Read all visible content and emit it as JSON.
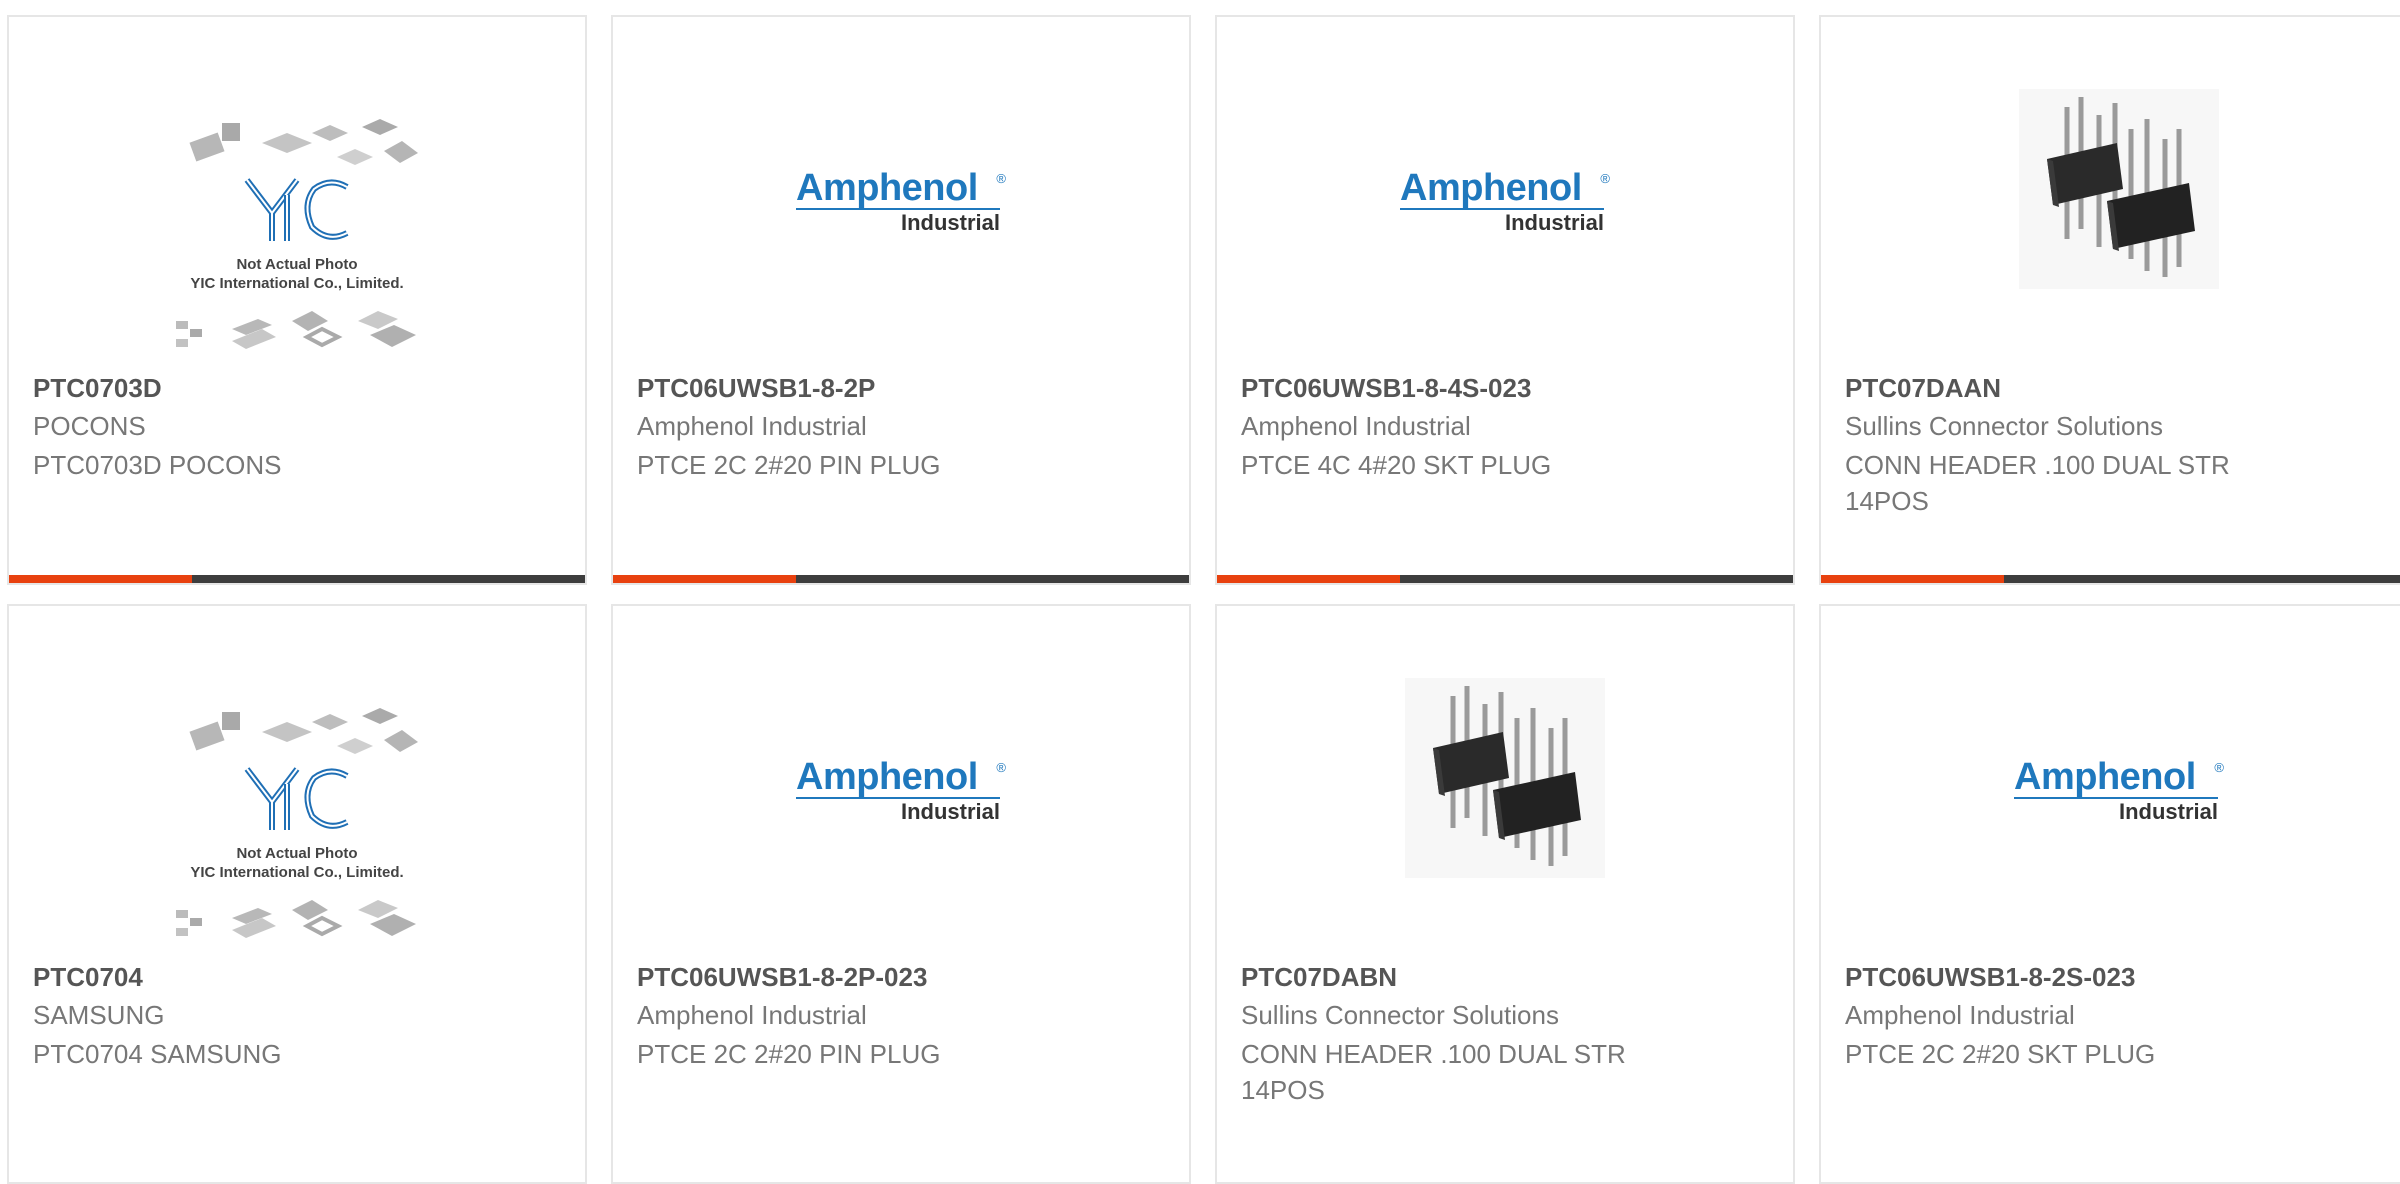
{
  "products": [
    {
      "part": "PTC0703D",
      "brand": "POCONS",
      "desc": "PTC0703D POCONS",
      "image": "yic-placeholder"
    },
    {
      "part": "PTC06UWSB1-8-2P",
      "brand": "Amphenol Industrial",
      "desc": "PTCE 2C 2#20 PIN PLUG",
      "image": "amphenol-logo"
    },
    {
      "part": "PTC06UWSB1-8-4S-023",
      "brand": "Amphenol Industrial",
      "desc": "PTCE 4C 4#20 SKT PLUG",
      "image": "amphenol-logo"
    },
    {
      "part": "PTC07DAAN",
      "brand": "Sullins Connector Solutions",
      "desc": "CONN HEADER .100 DUAL STR 14POS",
      "image": "pin-header-photo"
    },
    {
      "part": "PTC0704",
      "brand": "SAMSUNG",
      "desc": "PTC0704 SAMSUNG",
      "image": "yic-placeholder"
    },
    {
      "part": "PTC06UWSB1-8-2P-023",
      "brand": "Amphenol Industrial",
      "desc": "PTCE 2C 2#20 PIN PLUG",
      "image": "amphenol-logo"
    },
    {
      "part": "PTC07DABN",
      "brand": "Sullins Connector Solutions",
      "desc": "CONN HEADER .100 DUAL STR 14POS",
      "image": "pin-header-photo"
    },
    {
      "part": "PTC06UWSB1-8-2S-023",
      "brand": "Amphenol Industrial",
      "desc": "PTCE 2C 2#20 SKT PLUG",
      "image": "amphenol-logo"
    }
  ],
  "logos": {
    "amphenol_name": "Amphenol",
    "amphenol_reg": "®",
    "amphenol_sub": "Industrial",
    "yic_caption_1": "Not Actual Photo",
    "yic_caption_2": "YIC International Co., Limited."
  },
  "colors": {
    "accent": "#e8410f",
    "bar": "#3d3d3d",
    "amphenol_blue": "#1f78bd",
    "yic_blue": "#1f6fb5"
  }
}
